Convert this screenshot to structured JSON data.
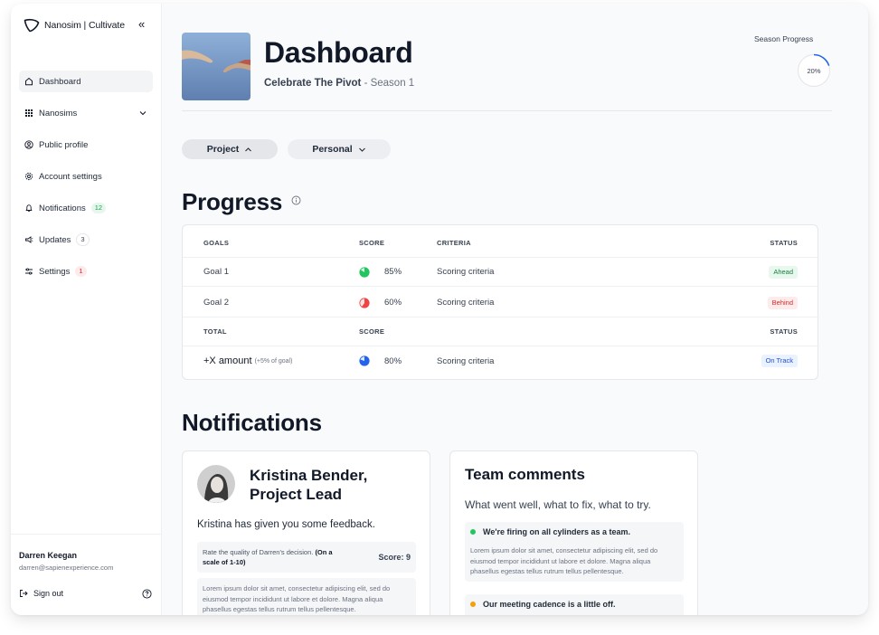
{
  "colors": {
    "accent": "#2563eb",
    "green": "#22c55e",
    "red": "#ef4444",
    "orange": "#f59e0b"
  },
  "sidebar": {
    "brand": "Nanosim | Cultivate",
    "collapse_icon": "«",
    "items": [
      {
        "label": "Dashboard",
        "icon": "home-icon"
      },
      {
        "label": "Nanosims",
        "icon": "grid-icon"
      },
      {
        "label": "Public profile",
        "icon": "user-circle-icon"
      },
      {
        "label": "Account settings",
        "icon": "gear-icon"
      },
      {
        "label": "Notifications",
        "icon": "bell-icon",
        "badge": "12"
      },
      {
        "label": "Updates",
        "icon": "megaphone-icon",
        "badge": "3"
      },
      {
        "label": "Settings",
        "icon": "sliders-icon",
        "badge": "1"
      }
    ],
    "user": {
      "name": "Darren Keegan",
      "email": "darren@sapienexperience.com"
    },
    "signout": "Sign out"
  },
  "header": {
    "title": "Dashboard",
    "subtitle_bold": "Celebrate The Pivot",
    "subtitle_rest": " - Season 1",
    "season_label": "Season Progress",
    "season_value": "20%",
    "season_fraction": 0.2
  },
  "filters": {
    "project": "Project",
    "personal": "Personal"
  },
  "progress": {
    "title": "Progress",
    "headers": {
      "goals": "GOALS",
      "score": "SCORE",
      "criteria": "CRITERIA",
      "status": "STATUS"
    },
    "rows": [
      {
        "goal": "Goal 1",
        "score": "85%",
        "criteria": "Scoring criteria",
        "status": "Ahead"
      },
      {
        "goal": "Goal 2",
        "score": "60%",
        "criteria": "Scoring criteria",
        "status": "Behind"
      }
    ],
    "total_headers": {
      "total": "TOTAL",
      "score": "SCORE",
      "status": "STATUS"
    },
    "total": {
      "label": "+X amount",
      "note": "(+5% of goal)",
      "score": "80%",
      "criteria": "Scoring criteria",
      "status": "On Track"
    }
  },
  "notifications": {
    "title": "Notifications",
    "feedback_card": {
      "name_line1": "Kristina Bender,",
      "name_line2": "Project Lead",
      "message": "Kristina has given you some feedback.",
      "rate_question": "Rate the quality of Darren's decision.",
      "rate_scale": "(On a scale of 1-10)",
      "score": "Score: 9",
      "lorem": "Lorem ipsum dolor sit amet, consectetur adipiscing elit, sed do eiusmod tempor incididunt ut labore et dolore. Magna aliqua phasellus egestas tellus rutrum tellus pellentesque."
    },
    "team_card": {
      "title": "Team comments",
      "subtitle": "What went well, what to fix, what to try.",
      "items": [
        {
          "heading": "We're firing on all cylinders as a team.",
          "body": "Lorem ipsum dolor sit amet, consectetur adipiscing elit, sed do eiusmod tempor incididunt ut labore et dolore. Magna aliqua phasellus egestas tellus rutrum tellus pellentesque."
        },
        {
          "heading": "Our meeting cadence is a little off."
        }
      ]
    }
  }
}
